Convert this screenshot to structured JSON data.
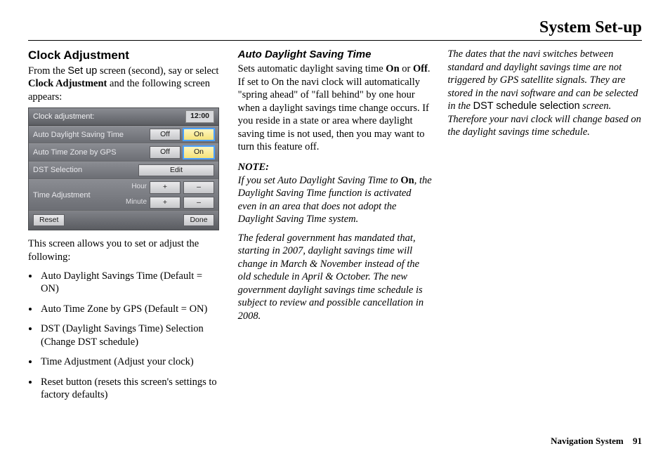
{
  "header": {
    "title": "System Set-up"
  },
  "footer": {
    "label": "Navigation System",
    "page": "91"
  },
  "col1": {
    "heading": "Clock Adjustment",
    "intro_pre": "From the ",
    "intro_setup": "Set up",
    "intro_mid": " screen (second), say or select ",
    "intro_ca": "Clock Adjustment",
    "intro_post": " and the following screen appears:",
    "after_device": "This screen allows you to set or adjust the following:",
    "bullets": [
      "Auto Daylight Savings Time (Default = ON)",
      "Auto Time Zone by GPS (Default = ON)",
      "DST (Daylight Savings Time) Selection\n(Change DST schedule)",
      "Time Adjustment (Adjust your clock)",
      "Reset button (resets this screen's settings to factory defaults)"
    ]
  },
  "device": {
    "title": "Clock adjustment:",
    "clock": "12:00",
    "rows": {
      "adst": {
        "label": "Auto Daylight Saving Time",
        "off": "Off",
        "on": "On"
      },
      "atz": {
        "label": "Auto Time Zone by GPS",
        "off": "Off",
        "on": "On"
      },
      "dst": {
        "label": "DST Selection",
        "edit": "Edit"
      },
      "ta": {
        "label": "Time Adjustment",
        "hour": "Hour",
        "minute": "Minute",
        "plus": "+",
        "minus": "–"
      }
    },
    "reset": "Reset",
    "done": "Done"
  },
  "col2": {
    "heading": "Auto Daylight Saving Time",
    "p1_pre": "Sets automatic daylight saving time ",
    "p1_on": "On",
    "p1_mid": " or ",
    "p1_off": "Off",
    "p1_post": ". If set to On the navi clock will automatically \"spring ahead\" of \"fall behind\" by one hour when a daylight savings time change occurs. If you reside in a state or area where daylight saving time is not used, then you may want to turn this feature off.",
    "note_label": "NOTE:",
    "note_pre": "If you set Auto Daylight Saving Time to ",
    "note_on": "On",
    "note_post": ", the Daylight Saving Time function is activated even in an area that does not adopt the Daylight Saving Time system.",
    "p2": "The federal government has mandated that, starting in 2007, daylight savings time will change in March & November instead of the old schedule in April & October. The new government daylight savings time schedule is subject to review and possible cancellation in 2008."
  },
  "col3": {
    "p_pre": "The dates that the navi switches between standard and daylight savings time are not triggered by GPS satellite signals. They are stored in the navi software and can be selected in the ",
    "p_dst": "DST schedule selection",
    "p_post": " screen. Therefore your navi clock will change based on the daylight savings time schedule."
  }
}
